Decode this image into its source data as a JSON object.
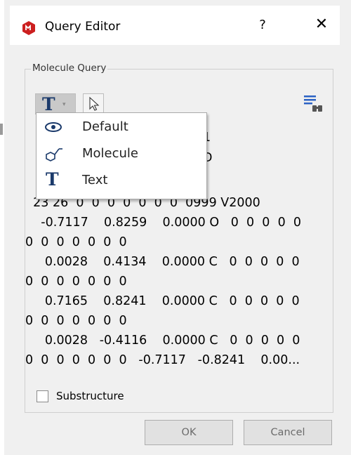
{
  "window": {
    "title": "Query Editor",
    "help": "?",
    "close": "✕"
  },
  "group": {
    "label": "Molecule Query"
  },
  "toolbar": {
    "text_tool_glyph": "T",
    "text_tool_caret": "▾",
    "pointer_icon": "pointer-arrow-icon",
    "search_icon": "find-structure-icon"
  },
  "dropdown": {
    "items": [
      {
        "icon": "eye-icon",
        "label": "Default"
      },
      {
        "icon": "molecule-icon",
        "label": "Molecule"
      },
      {
        "icon": "text-t-icon",
        "label": "Text"
      }
    ]
  },
  "query": {
    "partial_right_1": "1",
    "partial_right_2": "D",
    "lines": [
      "  23 26  0  0  0  0  0  0  0  0999 V2000",
      "    -0.7117    0.8259    0.0000 O   0  0  0  0  0",
      "0  0  0  0  0  0  0",
      "     0.0028    0.4134    0.0000 C   0  0  0  0  0",
      "0  0  0  0  0  0  0",
      "     0.7165    0.8241    0.0000 C   0  0  0  0  0",
      "0  0  0  0  0  0  0",
      "     0.0028   -0.4116    0.0000 C   0  0  0  0  0",
      "0  0  0  0  0  0  0   -0.7117   -0.8241    0.00..."
    ]
  },
  "options": {
    "substructure_label": "Substructure",
    "substructure_checked": false
  },
  "buttons": {
    "ok": "OK",
    "cancel": "Cancel"
  },
  "colors": {
    "app_icon": "#cc1f1f",
    "t_glyph": "#1b3a6b",
    "selected_tool_bg": "#c9c9c9"
  }
}
